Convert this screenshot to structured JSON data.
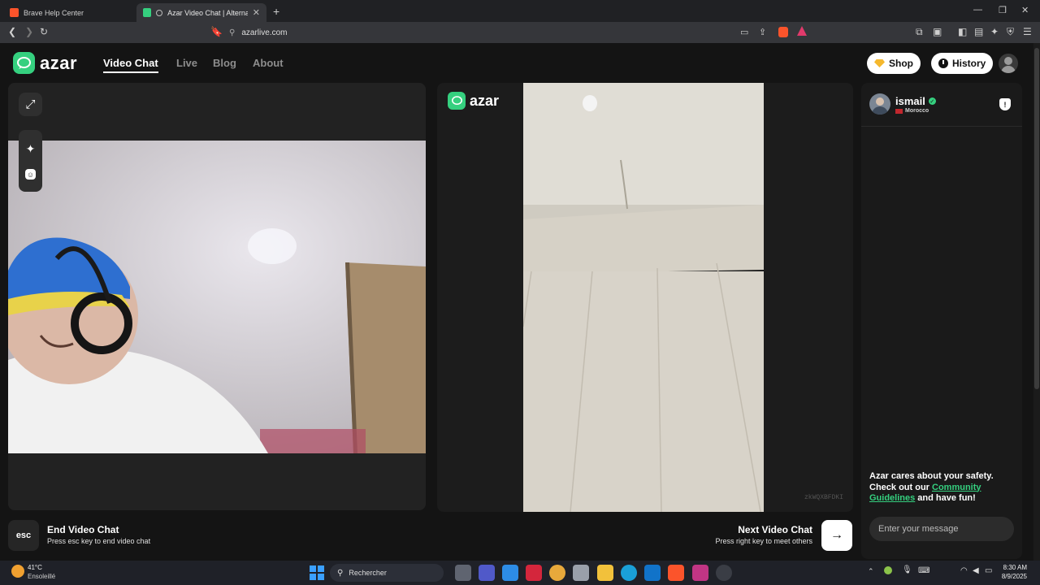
{
  "browser": {
    "tabs": [
      {
        "title": "Brave Help Center"
      },
      {
        "title": "Azar Video Chat | Alternative"
      }
    ],
    "url": "azarlive.com"
  },
  "site": {
    "logo_text": "azar",
    "nav": [
      "Video Chat",
      "Live",
      "Blog",
      "About"
    ],
    "shop_label": "Shop",
    "history_label": "History"
  },
  "remote": {
    "watermark": "azar",
    "session_id": "zkWQXBFDKI"
  },
  "peer": {
    "name": "ismail",
    "country": "Morocco"
  },
  "safety": {
    "line1": "Azar cares about your safety.",
    "line2_prefix": "Check out our ",
    "link": "Community Guidelines",
    "suffix": " and have fun!"
  },
  "chat": {
    "placeholder": "Enter your message"
  },
  "controls": {
    "esc_key": "esc",
    "end_title": "End Video Chat",
    "end_hint": "Press esc key to end video chat",
    "next_title": "Next Video Chat",
    "next_hint": "Press right key to meet others"
  },
  "taskbar": {
    "temp": "41°C",
    "weather": "Ensoleillé",
    "search": "Rechercher",
    "time": "8:30 AM",
    "date": "8/9/2025"
  },
  "colors": {
    "accent_green": "#35d07f",
    "background": "#141414",
    "panel": "#222222"
  }
}
